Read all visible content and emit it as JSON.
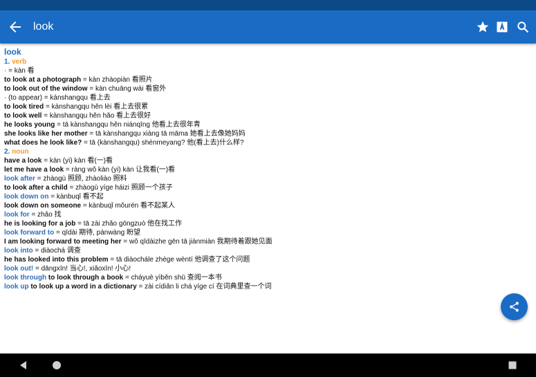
{
  "header": {
    "title": "look",
    "icons": [
      "back-arrow-icon",
      "star-icon",
      "font-size-icon",
      "search-icon"
    ]
  },
  "entry": {
    "headword": "look",
    "senses": [
      {
        "number": "1.",
        "pos": "verb",
        "lines": [
          {
            "bold": "",
            "text": "· = kàn 看"
          },
          {
            "bold": "to look at a photograph",
            "text": " = kàn zhàopiàn 看照片"
          },
          {
            "bold": "to look out of the window",
            "text": " = kàn chuāng wài 看窗外"
          },
          {
            "bold": "",
            "text": "· (to appear) = kànshangqu 看上去"
          },
          {
            "bold": "to look tired",
            "text": " = kànshangqu hěn lèi 看上去很累"
          },
          {
            "bold": "to look well",
            "text": " = kànshangqu hěn hǎo 看上去很好"
          },
          {
            "bold": "he looks young",
            "text": " = tā kànshangqu hěn niánqīng 他看上去很年青"
          },
          {
            "bold": "she looks like her mother",
            "text": " = tā kànshangqu xiàng tā māma 她看上去像她妈妈"
          },
          {
            "bold": "what does he look like?",
            "text": " = tā (kànshangqu) shénmeyang? 他(看上去)什么样?"
          }
        ]
      },
      {
        "number": "2.",
        "pos": "noun",
        "lines": [
          {
            "bold": "have a look",
            "text": " = kàn (yi) kàn 看(一)看"
          },
          {
            "bold": "let me have a look",
            "text": " = ràng wǒ kàn (yi) kàn 让我看(一)看"
          }
        ]
      }
    ],
    "phrasal": [
      {
        "xref": "look after",
        "bold": "",
        "text": " = zhàogù 照顾, zhàoliào 照料"
      },
      {
        "xref": "",
        "bold": "to look after a child",
        "text": " = zhàogù yíge háizi 照顾一个孩子"
      },
      {
        "xref": "look down on",
        "bold": "",
        "text": " = kànbuqǐ 看不起"
      },
      {
        "xref": "",
        "bold": "look down on someone",
        "text": " = kànbuqǐ mǒurén 看不起某人"
      },
      {
        "xref": "look for",
        "bold": "",
        "text": " = zhǎo 找"
      },
      {
        "xref": "",
        "bold": "he is looking for a job",
        "text": " = tā zài zhǎo gōngzuò 他在找工作"
      },
      {
        "xref": "look forward to",
        "bold": "",
        "text": " = qīdài 期待, pànwàng 盼望"
      },
      {
        "xref": "",
        "bold": "I am looking forward to meeting her",
        "text": " = wǒ qīdàizhe gēn tā jiànmiàn 我期待着跟她见面"
      },
      {
        "xref": "look into",
        "bold": "",
        "text": " = diàochá 调查"
      },
      {
        "xref": "",
        "bold": "he has looked into this problem",
        "text": " = tā diàochále zhège wèntí 他调查了这个问题"
      },
      {
        "xref": "look out!",
        "bold": "",
        "text": " = dāngxīn! 当心!, xiǎoxīn! 小心!"
      },
      {
        "xref": "look through",
        "bold": " to look through a book",
        "text": " = cháyuè yìběn shū 查阅一本书"
      },
      {
        "xref": "look up",
        "bold": " to look up a word in a dictionary",
        "text": " = zài cídiǎn li chá yíge cí 在词典里查一个词"
      }
    ]
  },
  "fab": {
    "icon": "share-icon"
  },
  "navbar": {
    "icons": [
      "nav-back-icon",
      "nav-home-icon",
      "nav-recents-icon"
    ]
  },
  "colors": {
    "appbar": "#1a6bc4",
    "statusbar": "#0b4a86",
    "pos": "#f29a2e",
    "link": "#2f6fba"
  }
}
